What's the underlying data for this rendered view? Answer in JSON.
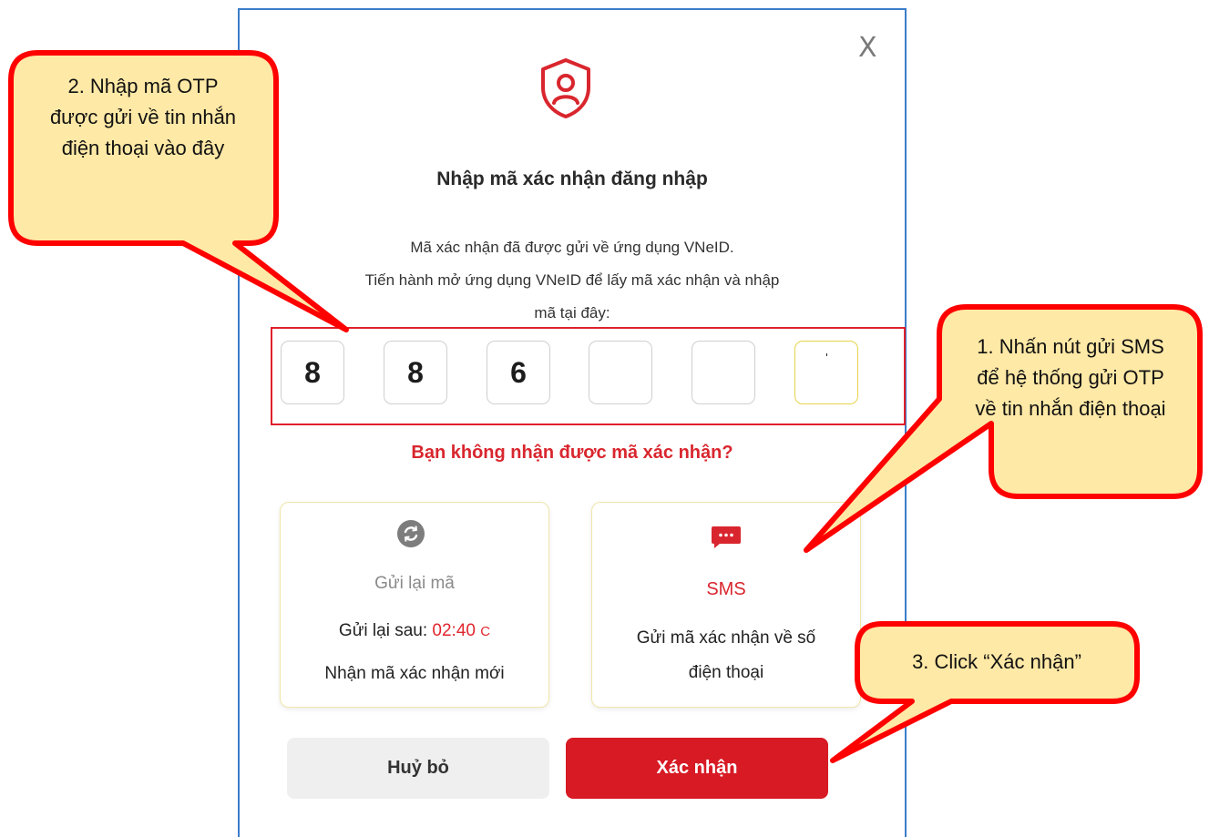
{
  "dialog": {
    "close_symbol": "X",
    "title": "Nhập mã xác nhận đăng nhập",
    "description_line1": "Mã xác nhận đã được gửi về ứng dụng VNeID.",
    "description_line2": "Tiến hành mở ứng dụng VNeID để lấy mã xác nhận và nhập",
    "description_line3": "mã tại đây:",
    "otp_digits": [
      "8",
      "8",
      "6",
      "",
      "",
      ""
    ],
    "resend_question": "Bạn không nhận được mã xác nhận?",
    "resend_card": {
      "icon": "refresh-icon",
      "title": "Gửi lại mã",
      "timer_label": "Gửi lại sau: ",
      "timer_value": "02:40",
      "timer_symbol": "C",
      "subtitle": "Nhận mã xác nhận mới"
    },
    "sms_card": {
      "icon": "sms-message-icon",
      "title": "SMS",
      "description": "Gửi mã xác nhận về số điện thoại"
    },
    "cancel_label": "Huỷ bỏ",
    "confirm_label": "Xác nhận"
  },
  "callouts": {
    "enter_otp": "2. Nhập mã OTP được gửi về tin nhắn điện thoại vào đây",
    "press_sms": "1. Nhấn nút gửi SMS để hệ thống gửi OTP về tin nhắn điện thoại",
    "click_confirm": "3. Click “Xác nhận”"
  },
  "colors": {
    "primary_red": "#d71a24",
    "callout_fill": "#ffe9a6",
    "callout_border": "#ff0000",
    "dialog_border": "#3a7dc9"
  }
}
